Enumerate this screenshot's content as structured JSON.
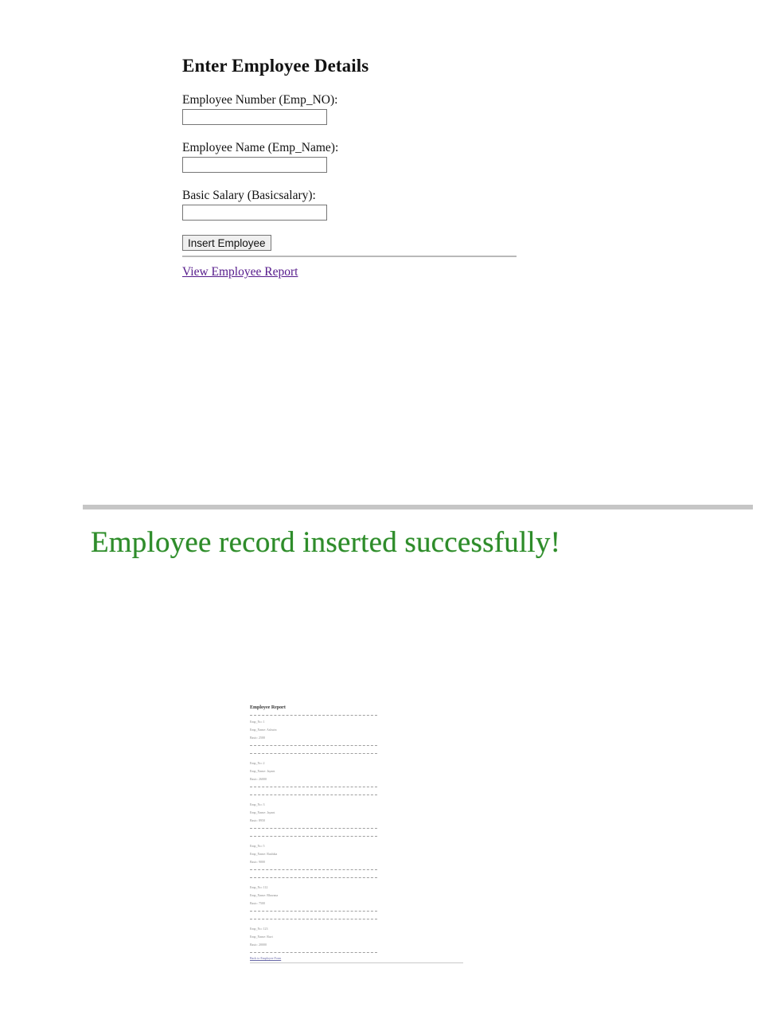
{
  "form": {
    "title": "Enter Employee Details",
    "fields": [
      {
        "label": "Employee Number (Emp_NO):",
        "value": ""
      },
      {
        "label": "Employee Name (Emp_Name):",
        "value": ""
      },
      {
        "label": "Basic Salary (Basicsalary):",
        "value": ""
      }
    ],
    "submit_label": "Insert Employee",
    "report_link": "View Employee Report"
  },
  "success": {
    "message": "Employee record inserted successfully!",
    "color": "#2e8b2a"
  },
  "report": {
    "title": "Employee Report",
    "records": [
      {
        "no": "Emp_No: 1",
        "name": "Emp_Name: Ashwin",
        "sal": "Basic: 2500"
      },
      {
        "no": "Emp_No: 2",
        "name": "Emp_Name: Jayant",
        "sal": "Basic: 26000"
      },
      {
        "no": "Emp_No: 3",
        "name": "Emp_Name: Jayant",
        "sal": "Basic: 8950"
      },
      {
        "no": "Emp_No: 5",
        "name": "Emp_Name: Rushika",
        "sal": "Basic: 9000"
      },
      {
        "no": "Emp_No: 112",
        "name": "Emp_Name: Bhavana",
        "sal": "Basic: 7500"
      },
      {
        "no": "Emp_No: 123",
        "name": "Emp_Name: Ravi",
        "sal": "Basic: 20000"
      }
    ],
    "back_link": "Back to Employee Form"
  }
}
